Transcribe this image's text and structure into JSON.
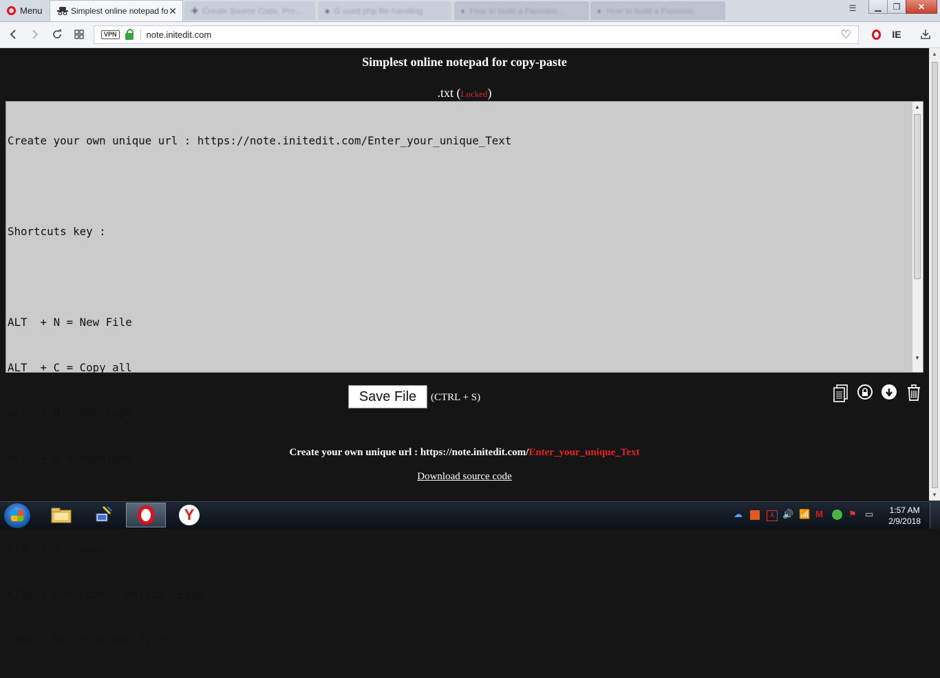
{
  "browser": {
    "menu_label": "Menu",
    "tabs": [
      {
        "label": "Simplest online notepad fo",
        "active": true
      },
      {
        "label": "Create Source Code, Pro…",
        "active": false
      },
      {
        "label": "G used php file handling",
        "active": false
      },
      {
        "label": "How to build a Pastebin…",
        "active": false
      },
      {
        "label": "How to build a Pastebin",
        "active": false
      }
    ],
    "vpn_label": "VPN",
    "url": "note.initedit.com",
    "ie_label": "IE"
  },
  "page": {
    "title": "Simplest online notepad for copy-paste",
    "file_ext": ".txt",
    "locked_label": "Locked",
    "editor_lines": [
      "Create your own unique url : https://note.initedit.com/Enter_your_unique_Text",
      "",
      "Shortcuts key :",
      "",
      "ALT  + N = New File",
      "ALT  + C = Copy all",
      "ALT  + U = URL Copy",
      "ALT  + D = Download",
      "",
      "CTRL + S = Save",
      "CTRL + L = Lock , Unlock, Edit",
      "CTRL + DEL = Delete File"
    ],
    "save_button": "Save File",
    "save_shortcut": "(CTRL + S)",
    "footer_prefix": "Create your own unique url : https://note.initedit.com/",
    "footer_highlight": "Enter_your_unique_Text",
    "download_link": "Download source code",
    "accent_red": "#e52222"
  },
  "taskbar": {
    "time": "1:57 AM",
    "date": "2/9/2018"
  }
}
